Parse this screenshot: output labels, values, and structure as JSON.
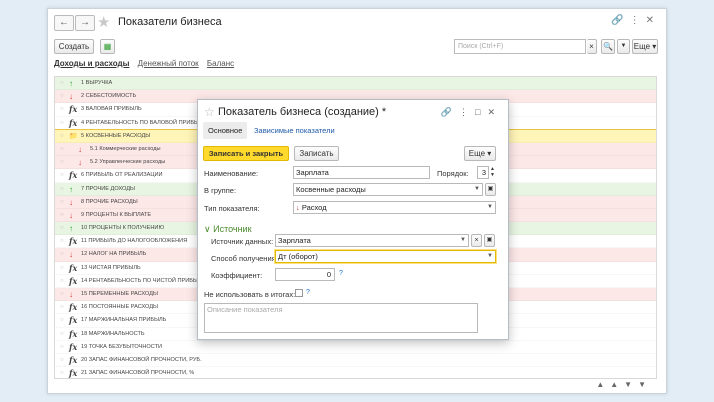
{
  "window": {
    "title": "Показатели бизнеса",
    "create_label": "Создать",
    "search_placeholder": "Поиск (Ctrl+F)",
    "more_label": "Еще"
  },
  "tabs": [
    "Доходы и расходы",
    "Денежный поток",
    "Баланс"
  ],
  "rows": [
    {
      "icon": "up",
      "num": "1",
      "label": "ВЫРУЧКА",
      "bg": "g"
    },
    {
      "icon": "dn",
      "num": "2",
      "label": "СЕБЕСТОИМОСТЬ",
      "bg": "p"
    },
    {
      "icon": "fx",
      "num": "3",
      "label": "ВАЛОВАЯ ПРИБЫЛЬ",
      "bg": ""
    },
    {
      "icon": "fx",
      "num": "4",
      "label": "РЕНТАБЕЛЬНОСТЬ ПО ВАЛОВОЙ ПРИБЫЛИ",
      "bg": ""
    },
    {
      "icon": "folder",
      "num": "5",
      "label": "КОСВЕННЫЕ РАСХОДЫ",
      "bg": "y"
    },
    {
      "icon": "dn",
      "num": "5.1",
      "label": "Коммерческие расходы",
      "bg": "p",
      "sub": true
    },
    {
      "icon": "dn",
      "num": "5.2",
      "label": "Управленческие расходы",
      "bg": "p",
      "sub": true
    },
    {
      "icon": "fx",
      "num": "6",
      "label": "ПРИБЫЛЬ ОТ РЕАЛИЗАЦИИ",
      "bg": ""
    },
    {
      "icon": "up",
      "num": "7",
      "label": "ПРОЧИЕ ДОХОДЫ",
      "bg": "g"
    },
    {
      "icon": "dn",
      "num": "8",
      "label": "ПРОЧИЕ РАСХОДЫ",
      "bg": "p"
    },
    {
      "icon": "dn",
      "num": "9",
      "label": "ПРОЦЕНТЫ К ВЫПЛАТЕ",
      "bg": "p"
    },
    {
      "icon": "up",
      "num": "10",
      "label": "ПРОЦЕНТЫ К ПОЛУЧЕНИЮ",
      "bg": "g"
    },
    {
      "icon": "fx",
      "num": "11",
      "label": "ПРИБЫЛЬ ДО НАЛОГООБЛОЖЕНИЯ",
      "bg": ""
    },
    {
      "icon": "dn",
      "num": "12",
      "label": "НАЛОГ НА ПРИБЫЛЬ",
      "bg": "p"
    },
    {
      "icon": "fx",
      "num": "13",
      "label": "ЧИСТАЯ ПРИБЫЛЬ",
      "bg": ""
    },
    {
      "icon": "fx",
      "num": "14",
      "label": "РЕНТАБЕЛЬНОСТЬ ПО ЧИСТОЙ ПРИБЫЛИ",
      "bg": ""
    },
    {
      "icon": "dn",
      "num": "15",
      "label": "ПЕРЕМЕННЫЕ РАСХОДЫ",
      "bg": "p"
    },
    {
      "icon": "fx",
      "num": "16",
      "label": "ПОСТОЯННЫЕ РАСХОДЫ",
      "bg": ""
    },
    {
      "icon": "fx",
      "num": "17",
      "label": "МАРЖИНАЛЬНАЯ ПРИБЫЛЬ",
      "bg": ""
    },
    {
      "icon": "fx",
      "num": "18",
      "label": "МАРЖИНАЛЬНОСТЬ",
      "bg": ""
    },
    {
      "icon": "fx",
      "num": "19",
      "label": "ТОЧКА БЕЗУБЫТОЧНОСТИ",
      "bg": ""
    },
    {
      "icon": "fx",
      "num": "20",
      "label": "ЗАПАС ФИНАНСОВОЙ ПРОЧНОСТИ, РУБ.",
      "bg": ""
    },
    {
      "icon": "fx",
      "num": "21",
      "label": "ЗАПАС ФИНАНСОВОЙ ПРОЧНОСТИ, %",
      "bg": ""
    }
  ],
  "dialog": {
    "title": "Показатель бизнеса (создание) *",
    "tab_main": "Основное",
    "tab_dependent": "Зависимые показатели",
    "save_close": "Записать и закрыть",
    "save": "Записать",
    "more": "Еще",
    "name_label": "Наименование:",
    "name_value": "Зарплата",
    "order_label": "Порядок:",
    "order_value": "3",
    "group_label": "В группе:",
    "group_value": "Косвенные расходы",
    "type_label": "Тип показателя:",
    "type_value": "Расход",
    "section_title": "Источник",
    "source_label": "Источник данных:",
    "source_value": "Зарплата",
    "method_label": "Способ получения:",
    "method_value": "Дт (оборот)",
    "coef_label": "Коэффициент:",
    "coef_value": "0",
    "exclude_label": "Не использовать в итогах:",
    "description_placeholder": "Описание показателя",
    "help": "?"
  }
}
